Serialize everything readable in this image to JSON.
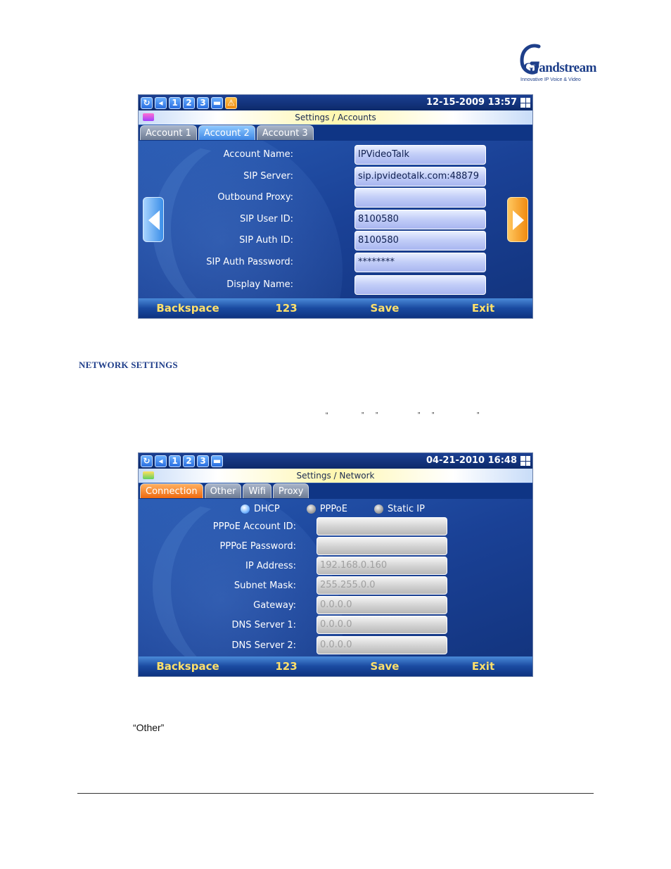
{
  "logo": {
    "brand": "Grandstream",
    "tagline": "Innovative IP Voice & Video"
  },
  "screen1": {
    "status_icons": [
      "1",
      "2",
      "3"
    ],
    "clock": "12-15-2009 13:57",
    "title": "Settings / Accounts",
    "tabs": [
      "Account 1",
      "Account 2",
      "Account 3"
    ],
    "fields": [
      {
        "label": "Account Name:",
        "value": "IPVideoTalk"
      },
      {
        "label": "SIP Server:",
        "value": "sip.ipvideotalk.com:48879"
      },
      {
        "label": "Outbound Proxy:",
        "value": ""
      },
      {
        "label": "SIP User ID:",
        "value": "8100580"
      },
      {
        "label": "SIP Auth ID:",
        "value": "8100580"
      },
      {
        "label": "SIP Auth Password:",
        "value": "********"
      },
      {
        "label": "Display Name:",
        "value": ""
      }
    ],
    "softkeys": [
      "Backspace",
      "123",
      "Save",
      "Exit"
    ]
  },
  "section_heading": "NETWORK SETTINGS",
  "quote_marks": [
    "“",
    "”",
    "”",
    "”",
    "”",
    "”"
  ],
  "screen2": {
    "status_icons": [
      "1",
      "2",
      "3"
    ],
    "clock": "04-21-2010 16:48",
    "title": "Settings / Network",
    "tabs": [
      "Connection",
      "Other",
      "Wifi",
      "Proxy"
    ],
    "radios": [
      "DHCP",
      "PPPoE",
      "Static IP"
    ],
    "fields": [
      {
        "label": "PPPoE Account ID:",
        "value": ""
      },
      {
        "label": "PPPoE Password:",
        "value": ""
      },
      {
        "label": "IP Address:",
        "value": "192.168.0.160"
      },
      {
        "label": "Subnet Mask:",
        "value": "255.255.0.0"
      },
      {
        "label": "Gateway:",
        "value": "0.0.0.0"
      },
      {
        "label": "DNS Server 1:",
        "value": "0.0.0.0"
      },
      {
        "label": "DNS Server 2:",
        "value": "0.0.0.0"
      }
    ],
    "softkeys": [
      "Backspace",
      "123",
      "Save",
      "Exit"
    ]
  },
  "other_text": "“Other”"
}
